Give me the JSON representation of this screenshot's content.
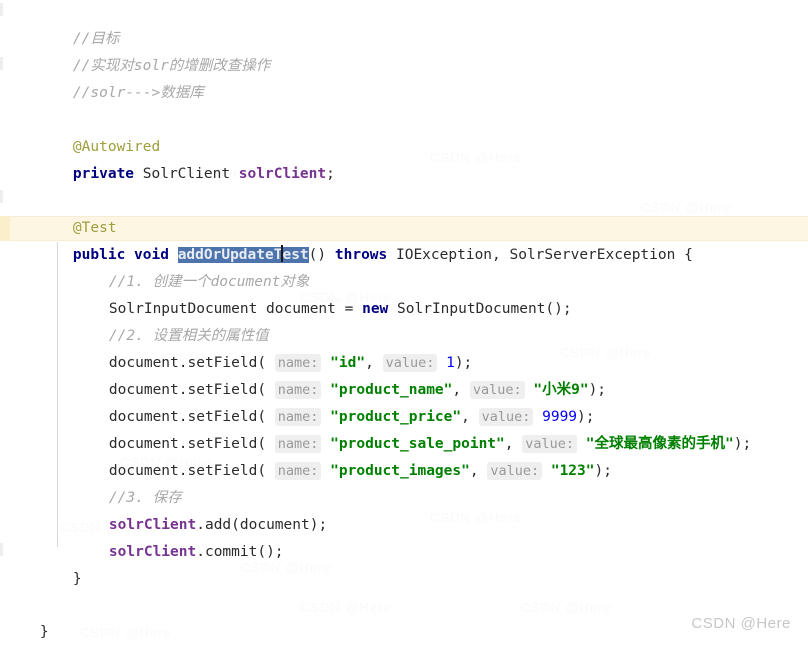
{
  "editor": {
    "theme_background": "#ffffff",
    "current_line_background": "#fdf6e3",
    "selection_background": "#4e74ad",
    "colors": {
      "keyword": "#000080",
      "annotation": "#9e9e3e",
      "comment": "#a8a8a8",
      "string": "#008000",
      "number": "#0000ff",
      "field": "#773390",
      "default_text": "#2b2b2b",
      "inlay_hint_text": "#999999",
      "inlay_hint_background": "#efefef"
    }
  },
  "selection": {
    "selected_text": "addOrUpdateTest",
    "caret_after": "addOrUpdateT"
  },
  "hints": {
    "name": "name:",
    "value": "value:"
  },
  "code": {
    "line01_comment": "//目标",
    "line02_comment": "//实现对solr的增删改查操作",
    "line03_comment": "//solr--->数据库",
    "line05_annotation": "@Autowired",
    "line06_kw": "private",
    "line06_type": " SolrClient ",
    "line06_field": "solrClient",
    "line06_semi": ";",
    "line08_annotation": "@Test",
    "line09_kw1": "public",
    "line09_kw2": "void",
    "line09_method": "addOrUpdateTest",
    "line09_parens": "()",
    "line09_kw3": "throws",
    "line09_exceptions": " IOException, SolrServerException ",
    "line09_brace": "{",
    "line10_comment": "//1. 创建一个document对象",
    "line11_pre": "SolrInputDocument document = ",
    "line11_kw": "new",
    "line11_post": " SolrInputDocument();",
    "line12_comment": "//2. 设置相关的属性值",
    "line13_call": "document.setField( ",
    "line13_name": "\"id\"",
    "line13_value": "1",
    "line13_tail": ");",
    "line14_call": "document.setField( ",
    "line14_name": "\"product_name\"",
    "line14_value": "\"小米9\"",
    "line14_tail": ");",
    "line15_call": "document.setField( ",
    "line15_name": "\"product_price\"",
    "line15_value": "9999",
    "line15_tail": ");",
    "line16_call": "document.setField( ",
    "line16_name": "\"product_sale_point\"",
    "line16_value": "\"全球最高像素的手机\"",
    "line16_tail": ");",
    "line17_call": "document.setField( ",
    "line17_name": "\"product_images\"",
    "line17_value": "\"123\"",
    "line17_tail": ");",
    "line18_comment": "//3. 保存",
    "line19_field": "solrClient",
    "line19_call": ".add(document);",
    "line20_field": "solrClient",
    "line20_call": ".commit();",
    "line21_brace": "}",
    "line23_brace": "}"
  },
  "watermark": {
    "footer": "CSDN @Here \u0001",
    "tile": "CSDN @Here"
  }
}
